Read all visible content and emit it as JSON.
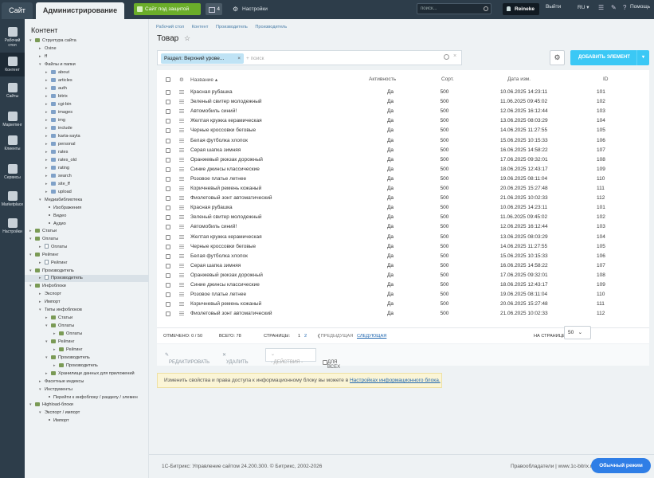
{
  "topbar": {
    "tab_site": "Сайт",
    "tab_admin": "Администрирование",
    "secure_label": "Сайт под защитой",
    "updates_count": "4",
    "settings_label": "Настройки",
    "search_placeholder": "поиск...",
    "user_name": "Reineke",
    "logout_label": "Выйти",
    "lang": "RU",
    "help_label": "Помощь"
  },
  "leftnav": {
    "items": [
      {
        "label": "Рабочий стол",
        "icon": "desktop-icon"
      },
      {
        "label": "Контент",
        "icon": "content-icon"
      },
      {
        "label": "Сайты",
        "icon": "sites-icon"
      },
      {
        "label": "Маркетинг",
        "icon": "marketing-icon"
      },
      {
        "label": "Клиенты",
        "icon": "clients-icon"
      },
      {
        "label": "Сервисы",
        "icon": "services-icon"
      },
      {
        "label": "Marketplace",
        "icon": "marketplace-icon"
      },
      {
        "label": "Настройки",
        "icon": "settings-icon"
      }
    ]
  },
  "tree": {
    "title": "Контент",
    "items": [
      "Структура сайта",
      "Ovine",
      "ff",
      "Файлы и папки",
      "about",
      "articles",
      "auth",
      "bitrix",
      "cgi-bin",
      "images",
      "img",
      "include",
      "karta-sayta",
      "personal",
      "rates",
      "rates_old",
      "rating",
      "search",
      "site_ff",
      "upload",
      "Медиабиблиотека",
      "Изображения",
      "Видео",
      "Аудио",
      "Статьи",
      "Оплаты",
      "Оплаты",
      "Рейтинг",
      "Рейтинг",
      "Производитель",
      "Производитель",
      "Инфоблоки",
      "Экспорт",
      "Импорт",
      "Типы инфоблоков",
      "Статьи",
      "Оплаты",
      "Оплаты",
      "Рейтинг",
      "Рейтинг",
      "Производитель",
      "Производитель",
      "Хранилище данных для приложений",
      "Фасетные индексы",
      "Инструменты",
      "Перейти к инфоблоку / разделу / элемен",
      "Highload-блоки",
      "Экспорт / импорт",
      "Импорт"
    ]
  },
  "breadcrumb": [
    "Рабочий стол",
    "Контент",
    "Производитель",
    "Производитель"
  ],
  "page_title": "Товар",
  "filter": {
    "chip": "Раздел: Верхний урове...",
    "placeholder": "+ поиск"
  },
  "add_button": "ДОБАВИТЬ ЭЛЕМЕНТ",
  "grid": {
    "headers": {
      "name": "Название",
      "active": "Активность",
      "sort": "Сорт.",
      "date": "Дата изм.",
      "id": "ID"
    },
    "rows": [
      {
        "name": "Красная рубашка",
        "active": "Да",
        "sort": "500",
        "date": "10.06.2025 14:23:11",
        "id": "101"
      },
      {
        "name": "Зеленый свитер молодежный",
        "active": "Да",
        "sort": "500",
        "date": "11.06.2025 09:45:02",
        "id": "102"
      },
      {
        "name": "Автомобиль синий!",
        "active": "Да",
        "sort": "500",
        "date": "12.06.2025 16:12:44",
        "id": "103"
      },
      {
        "name": "Желтая кружка керамическая",
        "active": "Да",
        "sort": "500",
        "date": "13.06.2025 08:03:29",
        "id": "104"
      },
      {
        "name": "Черные кроссовки беговые",
        "active": "Да",
        "sort": "500",
        "date": "14.06.2025 11:27:55",
        "id": "105"
      },
      {
        "name": "Белая футболка хлопок",
        "active": "Да",
        "sort": "500",
        "date": "15.06.2025 10:15:33",
        "id": "106"
      },
      {
        "name": "Серая шапка зимняя",
        "active": "Да",
        "sort": "500",
        "date": "16.06.2025 14:58:22",
        "id": "107"
      },
      {
        "name": "Оранжевый рюкзак дорожный",
        "active": "Да",
        "sort": "500",
        "date": "17.06.2025 09:32:01",
        "id": "108"
      },
      {
        "name": "Синие джинсы классические",
        "active": "Да",
        "sort": "500",
        "date": "18.06.2025 12:43:17",
        "id": "109"
      },
      {
        "name": "Розовое платье летнее",
        "active": "Да",
        "sort": "500",
        "date": "19.06.2025 08:11:04",
        "id": "110"
      },
      {
        "name": "Коричневый ремень кожаный",
        "active": "Да",
        "sort": "500",
        "date": "20.06.2025 15:27:48",
        "id": "111"
      },
      {
        "name": "Фиолетовый зонт автоматический",
        "active": "Да",
        "sort": "500",
        "date": "21.06.2025 10:02:33",
        "id": "112"
      },
      {
        "name": "Красная рубашка",
        "active": "Да",
        "sort": "500",
        "date": "10.06.2025 14:23:11",
        "id": "101"
      },
      {
        "name": "Зеленый свитер молодежный",
        "active": "Да",
        "sort": "500",
        "date": "11.06.2025 09:45:02",
        "id": "102"
      },
      {
        "name": "Автомобиль синий!",
        "active": "Да",
        "sort": "500",
        "date": "12.06.2025 16:12:44",
        "id": "103"
      },
      {
        "name": "Желтая кружка керамическая",
        "active": "Да",
        "sort": "500",
        "date": "13.06.2025 08:03:29",
        "id": "104"
      },
      {
        "name": "Черные кроссовки беговые",
        "active": "Да",
        "sort": "500",
        "date": "14.06.2025 11:27:55",
        "id": "105"
      },
      {
        "name": "Белая футболка хлопок",
        "active": "Да",
        "sort": "500",
        "date": "15.06.2025 10:15:33",
        "id": "106"
      },
      {
        "name": "Серая шапка зимняя",
        "active": "Да",
        "sort": "500",
        "date": "16.06.2025 14:58:22",
        "id": "107"
      },
      {
        "name": "Оранжевый рюкзак дорожный",
        "active": "Да",
        "sort": "500",
        "date": "17.06.2025 09:32:01",
        "id": "108"
      },
      {
        "name": "Синие джинсы классические",
        "active": "Да",
        "sort": "500",
        "date": "18.06.2025 12:43:17",
        "id": "109"
      },
      {
        "name": "Розовое платье летнее",
        "active": "Да",
        "sort": "500",
        "date": "19.06.2025 08:11:04",
        "id": "110"
      },
      {
        "name": "Коричневый ремень кожаный",
        "active": "Да",
        "sort": "500",
        "date": "20.06.2025 15:27:48",
        "id": "111"
      },
      {
        "name": "Фиолетовый зонт автоматический",
        "active": "Да",
        "sort": "500",
        "date": "21.06.2025 10:02:33",
        "id": "112"
      }
    ]
  },
  "pager": {
    "selected": "ОТМЕЧЕНО: 0 / 50",
    "total": "ВСЕГО: 78",
    "pages_label": "СТРАНИЦЫ:",
    "page1": "1",
    "page2": "2",
    "prev": "ПРЕДЫДУЩАЯ",
    "next": "СЛЕДУЮЩАЯ",
    "per_page_label": "НА СТРАНИЦЕ:",
    "per_page": "50"
  },
  "actions": {
    "edit": "РЕДАКТИРОВАТЬ",
    "delete": "УДАЛИТЬ",
    "select": "- ДЕЙСТВИЯ -",
    "for_all": "ДЛЯ ВСЕХ"
  },
  "hint": {
    "text": "Изменить свойства и права доступа к информационному блоку вы можете в ",
    "link": "Настройках информационного блока."
  },
  "footer": {
    "copyright": "1С-Битрикс: Управление сайтом 24.200.300. © Битрикс, 2002-2026",
    "rights": "Правообладатели",
    "separator": "|",
    "site": "www.1c-bitrix.ru",
    "mode_button": "Обычный режим"
  },
  "colors": {
    "topbar": "#2d3d4a",
    "accent": "#3bc8f5",
    "secure": "#6bad2a",
    "mode_button": "#2f7ee6"
  }
}
